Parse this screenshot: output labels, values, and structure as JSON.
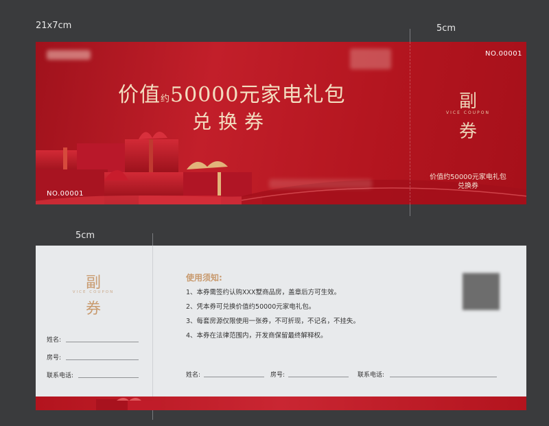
{
  "dimensions": {
    "front_size": "21x7cm",
    "front_stub": "5cm",
    "back_stub": "5cm"
  },
  "front": {
    "title_prefix": "价值",
    "title_small": "约",
    "title_main": "50000元家电礼包",
    "title_line2": "兑换券",
    "number_top": "NO.00001",
    "number_bottom": "NO.00001",
    "stub_char1": "副",
    "stub_char2": "券",
    "stub_sub": "VICE COUPON",
    "stub_line1": "价值约50000元家电礼包",
    "stub_line2": "兑换券"
  },
  "back": {
    "stub_char1": "副",
    "stub_char2": "券",
    "stub_sub": "VICE COUPON",
    "stub_fields": [
      "姓名:",
      "房号:",
      "联系电话:"
    ],
    "notice_title": "使用须知:",
    "rules": [
      "1、本券需签约认购XXX墅商品房，盖章后方可生效。",
      "2、凭本券可兑换价值约50000元家电礼包。",
      "3、每套房源仅限使用一张券，不可折现，不记名，不挂失。",
      "4、本券在法律范围内，开发商保留最终解释权。"
    ],
    "bottom_fields": [
      "姓名:",
      "房号:",
      "联系电话:"
    ]
  },
  "colors": {
    "background": "#3a3b3d",
    "ticket_red": "#b3151f",
    "gold": "#f3ddc0",
    "notice_gold": "#c89a6e",
    "back_bg": "#e8eaec"
  }
}
